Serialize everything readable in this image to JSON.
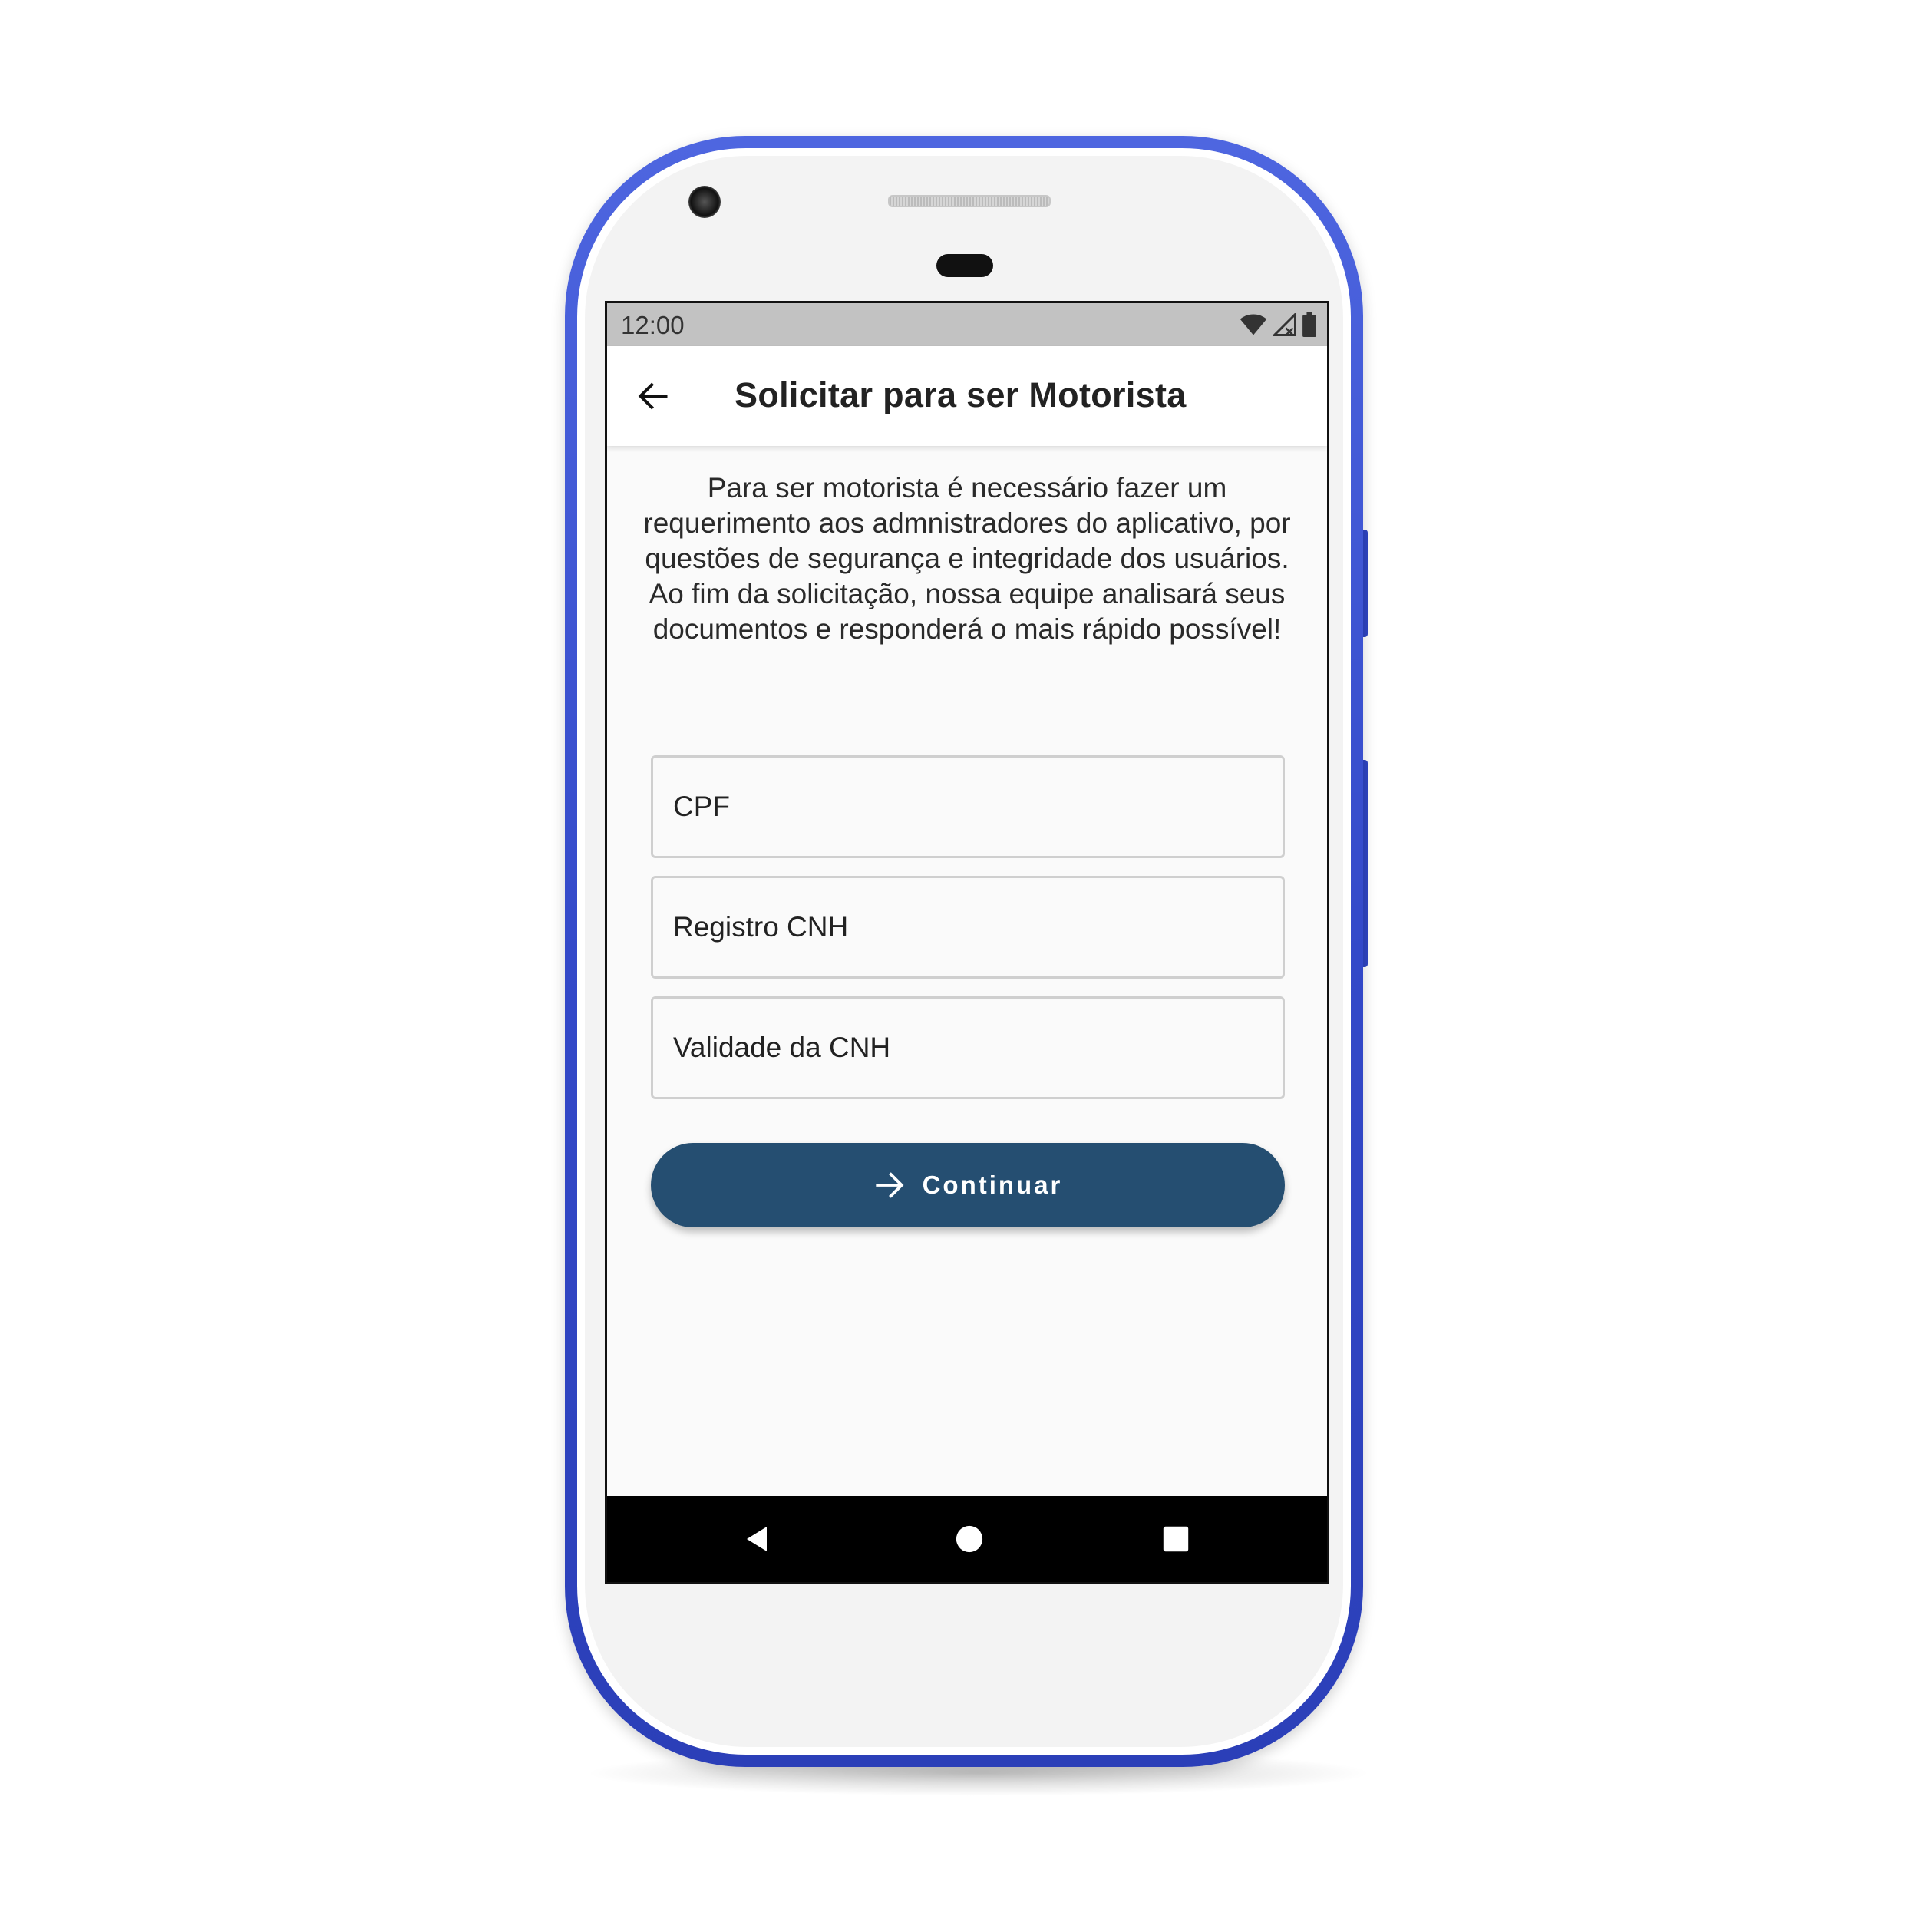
{
  "status_bar": {
    "time": "12:00",
    "icons": [
      "wifi-icon",
      "signal-icon",
      "battery-icon"
    ]
  },
  "app_bar": {
    "back_icon": "arrow-back-icon",
    "title": "Solicitar para ser Motorista"
  },
  "intro": {
    "text": "Para ser motorista é necessário fazer um requerimento aos admnistradores do aplicativo, por questões de segurança e integridade dos usuários. Ao fim da solicitação, nossa equipe analisará seus documentos e responderá o mais rápido possível!"
  },
  "form": {
    "cpf": {
      "placeholder": "CPF",
      "value": ""
    },
    "cnh_registro": {
      "placeholder": "Registro CNH",
      "value": ""
    },
    "cnh_validade": {
      "placeholder": "Validade da CNH",
      "value": ""
    }
  },
  "continue_button": {
    "label": "Continuar",
    "icon": "arrow-forward-icon"
  },
  "nav_bar": {
    "icons": [
      "nav-back-icon",
      "nav-home-icon",
      "nav-recents-icon"
    ]
  },
  "colors": {
    "primary": "#254e71",
    "device_frame": "#3349c9",
    "status_bar": "#c2c2c2",
    "background": "#fafafa"
  }
}
